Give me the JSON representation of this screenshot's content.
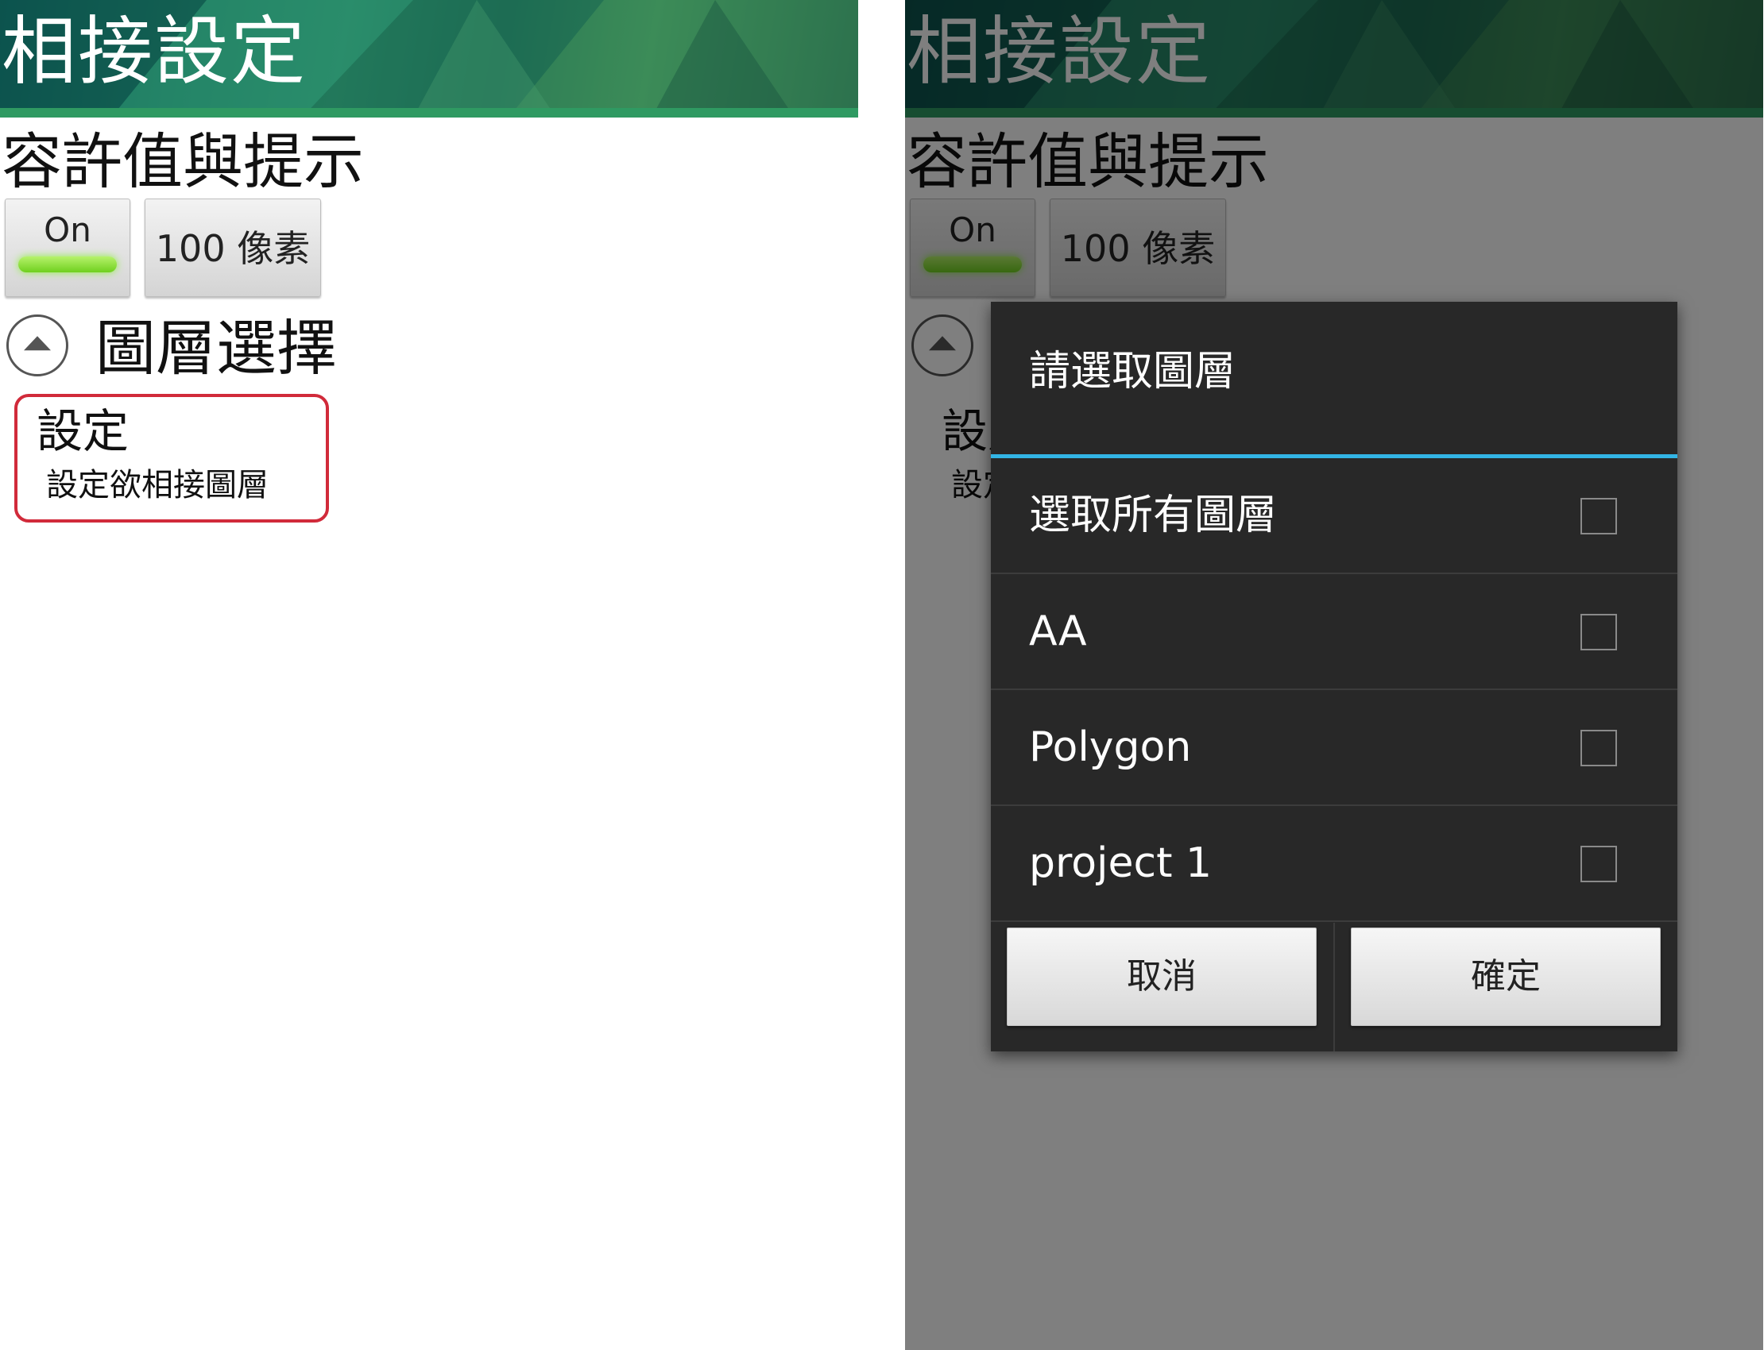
{
  "screen": {
    "header_title": "相接設定",
    "section_title": "容許值與提示",
    "toggle_label": "On",
    "pixel_button_label": "100 像素",
    "layer_section_title": "圖層選擇",
    "setting_item": {
      "title": "設定",
      "subtitle": "設定欲相接圖層"
    }
  },
  "dialog": {
    "title": "請選取圖層",
    "items": [
      {
        "label": "選取所有圖層",
        "checked": false
      },
      {
        "label": "AA",
        "checked": false
      },
      {
        "label": "Polygon",
        "checked": false
      },
      {
        "label": "project 1",
        "checked": false
      }
    ],
    "cancel_label": "取消",
    "ok_label": "確定"
  },
  "colors": {
    "header_green": "#1f7a5f",
    "toggle_on": "#7ed321",
    "highlight_border": "#d12a3a",
    "dialog_bg": "#282828",
    "dialog_accent": "#33b5e5"
  }
}
